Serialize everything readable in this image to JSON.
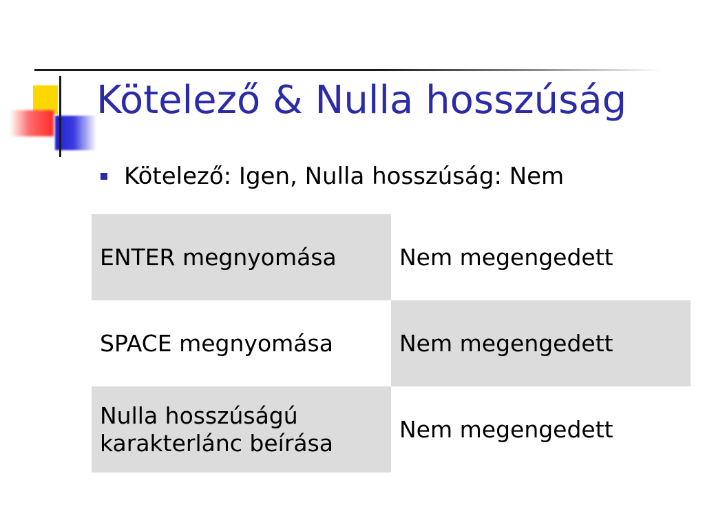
{
  "slide": {
    "title": "Kötelező & Nulla hosszúság",
    "bullet": "Kötelező: Igen, Nulla hosszúság: Nem",
    "accent_color": "#2b2ba8",
    "table": {
      "rows": [
        {
          "action": "ENTER megnyomása",
          "result": "Nem megengedett"
        },
        {
          "action": "SPACE megnyomása",
          "result": "Nem megengedett"
        },
        {
          "action": "Nulla hosszúságú\nkarakterlánc beírása",
          "result": "Nem megengedett"
        }
      ],
      "shading_color": "#dcdcdc"
    }
  }
}
